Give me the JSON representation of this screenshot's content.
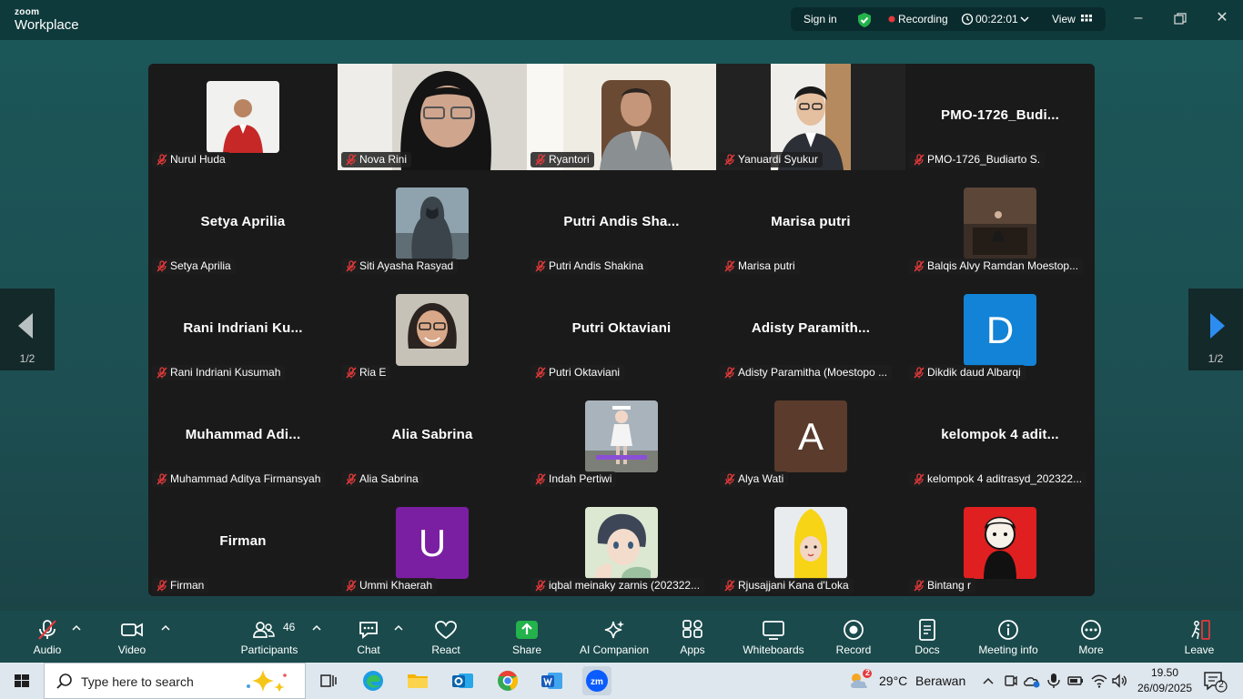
{
  "app": {
    "brand_top": "zoom",
    "brand_bottom": "Workplace"
  },
  "topbar": {
    "sign_in": "Sign in",
    "recording_label": "Recording",
    "timer": "00:22:01",
    "view_label": "View"
  },
  "meeting": {
    "page_indicator_left": "1/2",
    "page_indicator_right": "1/2",
    "participants": [
      {
        "name": "Nurul Huda",
        "display": "",
        "kind": "avatar",
        "avatar": "photo-red-shirt"
      },
      {
        "name": "Nova Rini",
        "display": "",
        "kind": "video",
        "avatar": "video-hijab"
      },
      {
        "name": "Ryantori",
        "display": "",
        "kind": "video",
        "avatar": "video-office"
      },
      {
        "name": "Yanuardi Syukur",
        "display": "",
        "kind": "video",
        "avatar": "video-glasses",
        "active": true
      },
      {
        "name": "PMO-1726_Budiarto S.",
        "display": "PMO-1726_Budi...",
        "kind": "name"
      },
      {
        "name": "Setya Aprilia",
        "display": "Setya Aprilia",
        "kind": "name"
      },
      {
        "name": "Siti Ayasha Rasyad",
        "display": "",
        "kind": "avatar",
        "avatar": "photo-assassin"
      },
      {
        "name": "Putri Andis Shakina",
        "display": "Putri Andis Sha...",
        "kind": "name"
      },
      {
        "name": "Marisa putri",
        "display": "Marisa putri",
        "kind": "name"
      },
      {
        "name": "Balqis Alvy Ramdan Moestop...",
        "display": "",
        "kind": "avatar",
        "avatar": "photo-dark-room"
      },
      {
        "name": "Rani Indriani Kusumah",
        "display": "Rani Indriani Ku...",
        "kind": "name"
      },
      {
        "name": "Ria E",
        "display": "",
        "kind": "avatar",
        "avatar": "photo-woman-glasses"
      },
      {
        "name": "Putri Oktaviani",
        "display": "Putri Oktaviani",
        "kind": "name"
      },
      {
        "name": "Adisty Paramitha (Moestopo ...",
        "display": "Adisty Paramith...",
        "kind": "name"
      },
      {
        "name": "Dikdik daud Albarqi",
        "display": "",
        "kind": "letter",
        "letter": "D",
        "color": "#1283d6"
      },
      {
        "name": "Muhammad Aditya Firmansyah",
        "display": "Muhammad Adi...",
        "kind": "name"
      },
      {
        "name": "Alia Sabrina",
        "display": "Alia Sabrina",
        "kind": "name"
      },
      {
        "name": "Indah Pertiwi",
        "display": "",
        "kind": "avatar",
        "avatar": "photo-game-girl"
      },
      {
        "name": "Alya Wati",
        "display": "",
        "kind": "letter",
        "letter": "A",
        "color": "#5a3b2c"
      },
      {
        "name": "kelompok 4 aditrasyd_202322...",
        "display": "kelompok 4 adit...",
        "kind": "name"
      },
      {
        "name": "Firman",
        "display": "Firman",
        "kind": "name"
      },
      {
        "name": "Ummi Khaerah",
        "display": "",
        "kind": "letter",
        "letter": "U",
        "color": "#7b1fa2"
      },
      {
        "name": "iqbal meinaky zarnis (202322...",
        "display": "",
        "kind": "avatar",
        "avatar": "photo-anime-boy"
      },
      {
        "name": "Rjusajjani Kana d'Loka",
        "display": "",
        "kind": "avatar",
        "avatar": "photo-banana"
      },
      {
        "name": "Bintang r",
        "display": "",
        "kind": "avatar",
        "avatar": "photo-red-sketch"
      }
    ]
  },
  "toolbar": {
    "audio": "Audio",
    "video": "Video",
    "participants": "Participants",
    "participants_count": "46",
    "chat": "Chat",
    "react": "React",
    "share": "Share",
    "ai_companion": "AI Companion",
    "apps": "Apps",
    "whiteboards": "Whiteboards",
    "record": "Record",
    "docs": "Docs",
    "meeting_info": "Meeting info",
    "more": "More",
    "leave": "Leave"
  },
  "taskbar": {
    "search_placeholder": "Type here to search",
    "weather_temp": "29°C",
    "weather_text": "Berawan",
    "weather_badge": "2",
    "time": "19.50",
    "date": "26/09/2025",
    "notif_count": "2"
  },
  "colors": {
    "accent_green": "#34c759",
    "share_green": "#23b24b",
    "recording_red": "#e5393a",
    "muted_red": "#e5393a"
  }
}
